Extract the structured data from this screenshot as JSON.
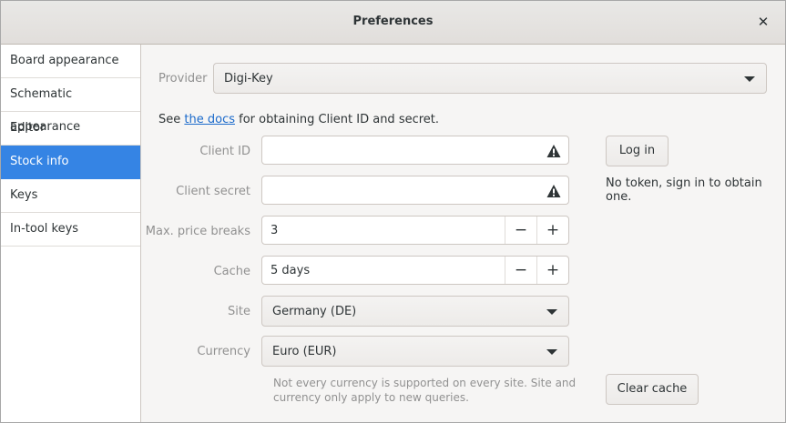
{
  "window": {
    "title": "Preferences"
  },
  "sidebar": {
    "items": [
      {
        "label": "Board appearance"
      },
      {
        "label": "Schematic appearance"
      },
      {
        "label": "Editor"
      },
      {
        "label": "Stock info",
        "active": true
      },
      {
        "label": "Keys"
      },
      {
        "label": "In-tool keys"
      }
    ]
  },
  "provider": {
    "label": "Provider",
    "value": "Digi-Key"
  },
  "docs": {
    "prefix": "See ",
    "link": "the docs",
    "suffix": " for obtaining Client ID and secret."
  },
  "client_id": {
    "label": "Client ID",
    "value": "",
    "icon": "warning-icon"
  },
  "client_secret": {
    "label": "Client secret",
    "value": "",
    "icon": "warning-icon"
  },
  "max_price_breaks": {
    "label": "Max. price breaks",
    "value": "3"
  },
  "cache": {
    "label": "Cache",
    "value": "5 days"
  },
  "site": {
    "label": "Site",
    "value": "Germany (DE)"
  },
  "currency": {
    "label": "Currency",
    "value": "Euro (EUR)"
  },
  "note": {
    "line1": "Not every currency is supported on every site. Site and",
    "line2": "currency only apply to new queries."
  },
  "login": {
    "button": "Log in",
    "status": "No token, sign in to obtain one."
  },
  "clear_cache": {
    "button": "Clear cache"
  },
  "spin": {
    "minus": "−",
    "plus": "+"
  },
  "colors": {
    "accent": "#3584e4",
    "link": "#1b6acb",
    "label": "#919191"
  }
}
